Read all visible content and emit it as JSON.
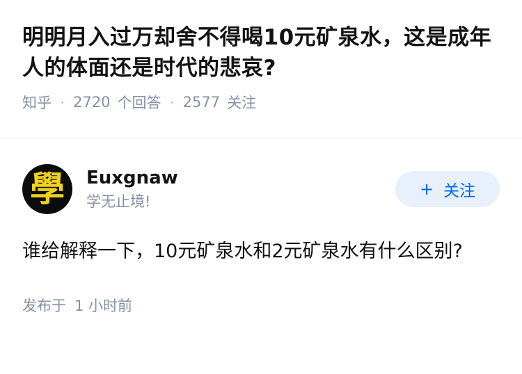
{
  "question": {
    "title": "明明月入过万却舍不得喝10元矿泉水，这是成年人的体面还是时代的悲哀?",
    "source": "知乎",
    "answers_count": "2720",
    "answers_label": "个回答",
    "followers_count": "2577",
    "followers_label": "关注"
  },
  "answer": {
    "author": {
      "name": "Euxgnaw",
      "bio": "学无止境!",
      "avatar_glyph": "學"
    },
    "follow_button": {
      "plus": "+",
      "label": "关注"
    },
    "content": "谁给解释一下，10元矿泉水和2元矿泉水有什么区别?",
    "posted_label": "发布于",
    "posted_time": "1 小时前"
  },
  "colors": {
    "text_primary": "#121212",
    "text_secondary": "#8590a6",
    "follow_bg": "#e8f1fb",
    "follow_text": "#0066ff",
    "avatar_bg": "#0b0b0b",
    "avatar_glyph": "#f0d21a"
  },
  "icons": {
    "follow": "plus-icon"
  }
}
